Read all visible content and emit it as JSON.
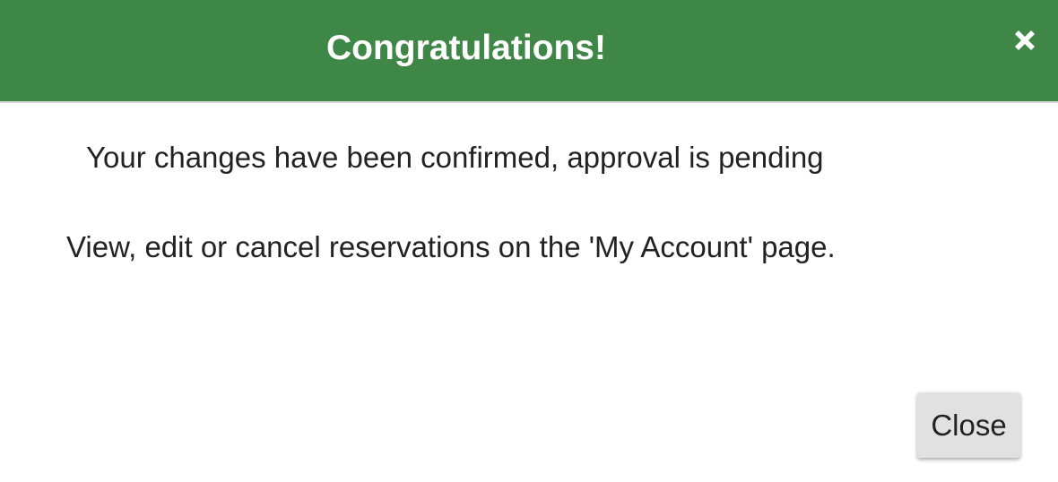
{
  "dialog": {
    "title": "Congratulations!",
    "close_icon": "close-x-icon",
    "message_primary": "Your changes have been confirmed, approval is pending",
    "message_secondary": "View, edit or cancel reservations on the 'My Account' page.",
    "close_button_label": "Close"
  },
  "colors": {
    "header_background": "#3e8747",
    "header_text": "#ffffff",
    "body_text": "#222222",
    "button_background": "#e1e1e1"
  }
}
